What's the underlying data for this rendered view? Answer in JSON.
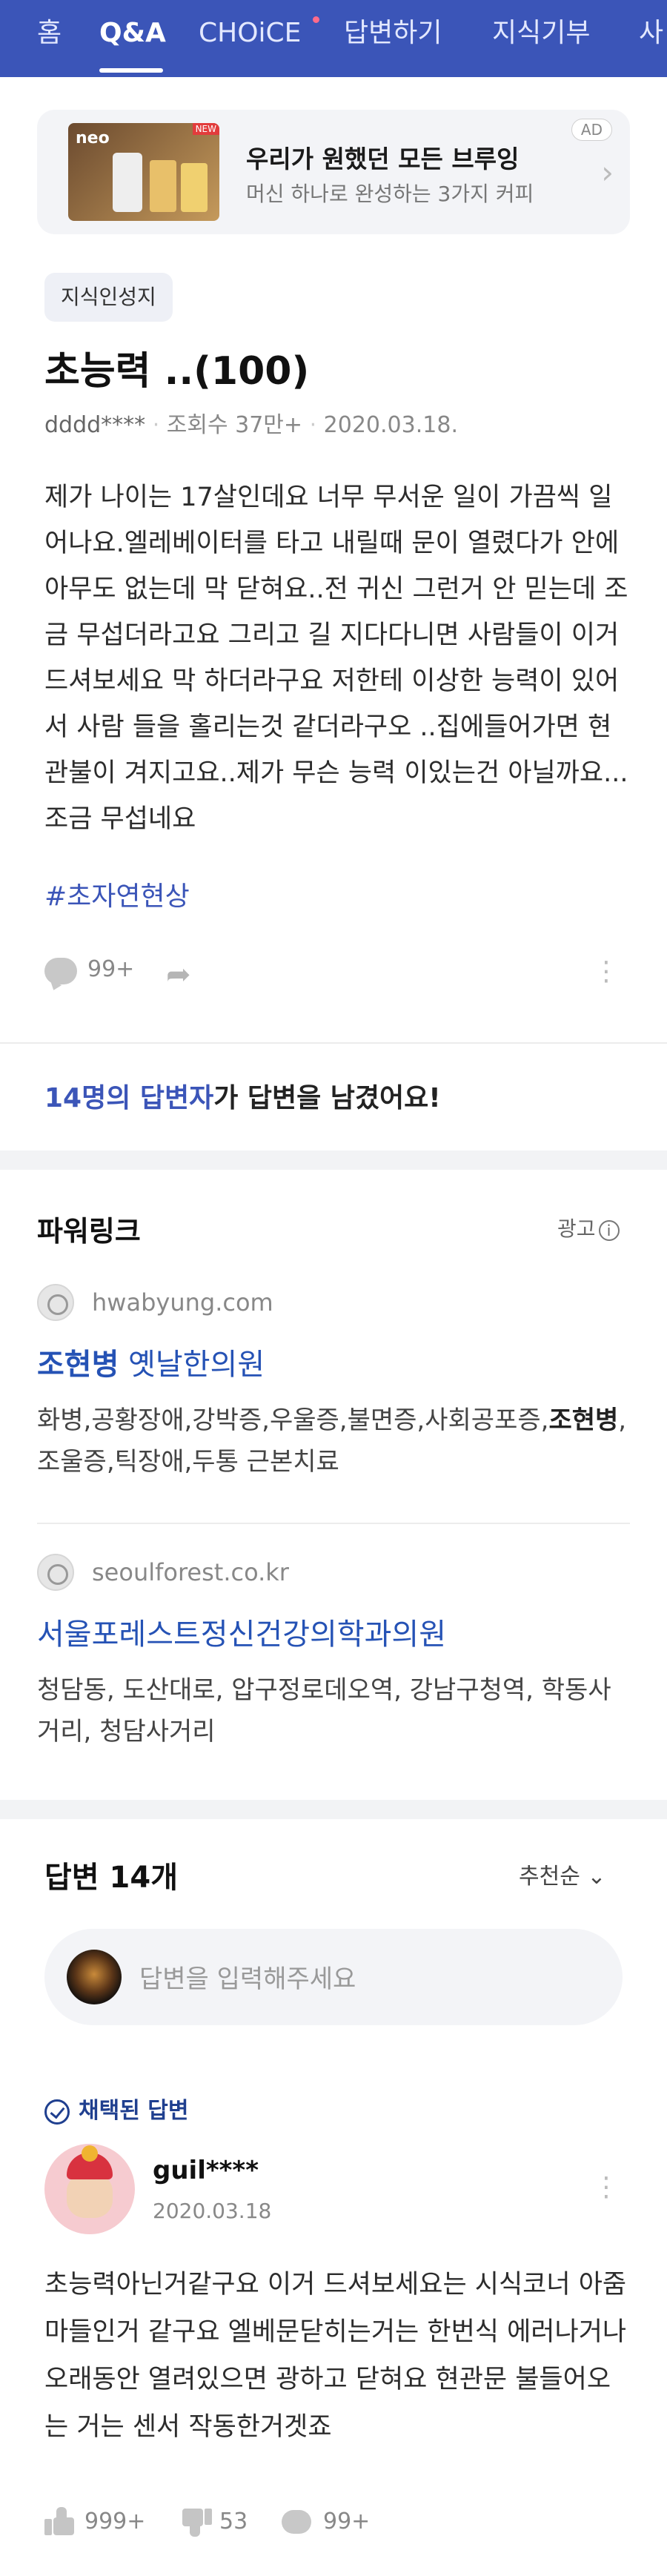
{
  "nav": {
    "items": [
      "홈",
      "Q&A",
      "CHOiCE",
      "답변하기",
      "지식기부",
      "사"
    ],
    "active": "Q&A",
    "accent": "#3b55b8"
  },
  "ad_banner": {
    "thumb_brand": "neo",
    "thumb_badge": "NEW",
    "title": "우리가 원했던 모든 브루잉",
    "subtitle": "머신 하나로 완성하는 3가지 커피",
    "tag": "AD"
  },
  "question": {
    "category": "지식인성지",
    "title": "초능력 ..(100)",
    "author": "dddd****",
    "views": "조회수 37만+",
    "date": "2020.03.18.",
    "body": "제가 나이는 17살인데요 너무 무서운 일이 가끔씩 일어나요.엘레베이터를 타고 내릴때 문이 열렸다가 안에 아무도 없는데 막 닫혀요..전 귀신 그런거 안 믿는데 조금 무섭더라고요 그리고 길 지다다니면 사람들이 이거 드셔보세요 막 하더라구요 저한테 이상한 능력이 있어서 사람 들을 홀리는것 같더라구오 ..집에들어가면 현관불이 겨지고요..제가 무슨 능력 이있는건 아닐까요... 조금 무섭네요",
    "hashtag": "#초자연현상",
    "comment_count": "99+"
  },
  "answerers": {
    "count_text": "14명의 답변자",
    "suffix": "가 답변을 남겼어요!"
  },
  "powerlink": {
    "header": "파워링크",
    "ad_label": "광고",
    "items": [
      {
        "domain": "hwabyung.com",
        "title_bold": "조현병",
        "title_rest": " 옛날한의원",
        "desc_a": "화병,공황장애,강박증,우울증,불면증,사회공포증,",
        "desc_bold": "조현병",
        "desc_b": ",조울증,틱장애,두통 근본치료"
      },
      {
        "domain": "seoulforest.co.kr",
        "title": "서울포레스트정신건강의학과의원",
        "desc": "청담동, 도산대로, 압구정로데오역, 강남구청역, 학동사거리, 청담사거리"
      }
    ]
  },
  "answers": {
    "header": "답변 14개",
    "sort_label": "추천순",
    "input_placeholder": "답변을 입력해주세요",
    "chosen_label": "채택된 답변",
    "first": {
      "username": "guil****",
      "date": "2020.03.18",
      "body": "초능력아닌거같구요 이거 드셔보세요는 시식코너 아줌마들인거 같구요 엘베문닫히는거는 한번식 에러나거나 오래동안 열려있으면 광하고 닫혀요 현관문 불들어오는 거는 센서 작동한거겟죠",
      "likes": "999+",
      "dislikes": "53",
      "comments": "99+"
    }
  }
}
